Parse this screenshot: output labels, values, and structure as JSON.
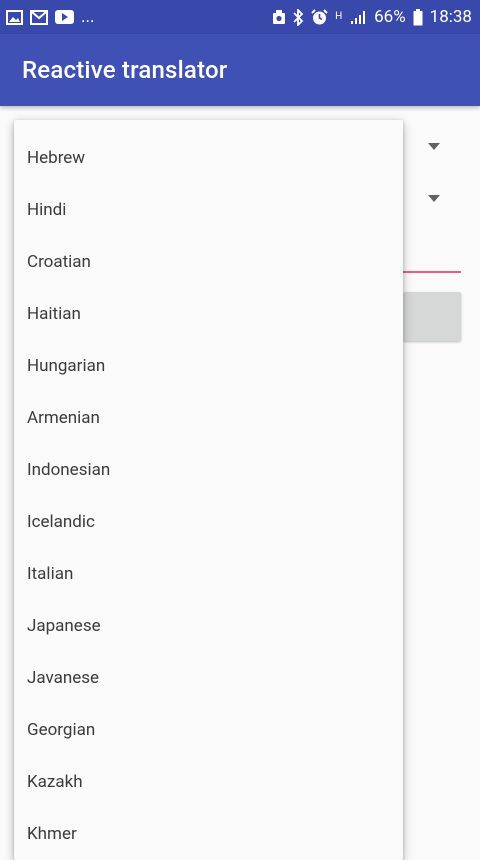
{
  "status_bar": {
    "notification_more": "...",
    "signal_label": "H",
    "battery_percent": "66%",
    "time": "18:38",
    "icons": [
      "gallery-icon",
      "email-icon",
      "youtube-icon",
      "sync-icon",
      "bluetooth-icon",
      "alarm-icon",
      "signal-icon",
      "battery-icon"
    ]
  },
  "app_bar": {
    "title": "Reactive translator"
  },
  "colors": {
    "status_bar": "#3949ab",
    "app_bar": "#3f51b5",
    "accent_underline": "#ef5b7d"
  },
  "language_dropdown": {
    "items": [
      "Hebrew",
      "Hindi",
      "Croatian",
      "Haitian",
      "Hungarian",
      "Armenian",
      "Indonesian",
      "Icelandic",
      "Italian",
      "Japanese",
      "Javanese",
      "Georgian",
      "Kazakh",
      "Khmer"
    ]
  }
}
